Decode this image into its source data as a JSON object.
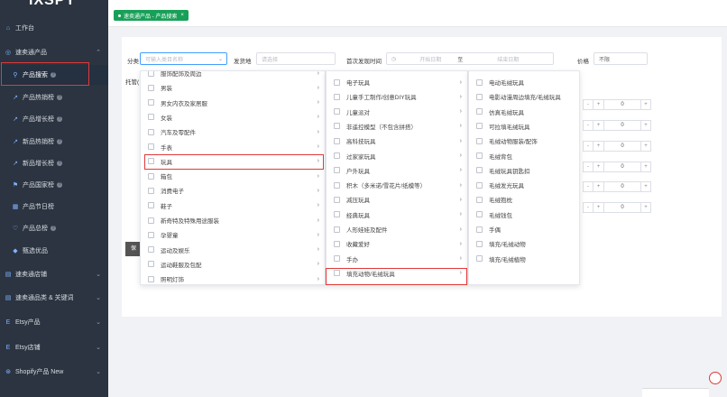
{
  "app": {
    "logo": "IXSPY",
    "fragment_top": "..."
  },
  "sidebar": {
    "workspace": "工作台",
    "groups": [
      {
        "label": "速卖通产品"
      },
      {
        "label": "速卖通店铺"
      },
      {
        "label": "速卖通品类 & 关键词"
      },
      {
        "label": "Etsy产品"
      },
      {
        "label": "Etsy店铺"
      },
      {
        "label": "Shopify产品 New"
      }
    ],
    "sub_items": [
      {
        "label": "产品搜索"
      },
      {
        "label": "产品热销榜"
      },
      {
        "label": "产品增长榜"
      },
      {
        "label": "新品热销榜"
      },
      {
        "label": "新品增长榜"
      },
      {
        "label": "产品国家榜"
      },
      {
        "label": "产品节日榜"
      },
      {
        "label": "产品总榜"
      },
      {
        "label": "甄选优品"
      }
    ]
  },
  "tabs": [
    {
      "label": "速卖通产品 - 产品搜索",
      "close": "×"
    }
  ],
  "filters": {
    "category_label": "分类",
    "category_placeholder": "可输入类目名称",
    "ship_from_label": "发货地",
    "ship_from_placeholder": "请选择",
    "first_found_label": "首次发现时间",
    "start_placeholder": "开始日期",
    "to_label": "至",
    "end_placeholder": "结束日期",
    "price_label": "价格",
    "price_value": "不限",
    "trusteeship_label": "托管(",
    "save_fragment": "保"
  },
  "steppers": [
    {
      "value": "0"
    },
    {
      "value": "0"
    },
    {
      "value": "0"
    },
    {
      "value": "0"
    },
    {
      "value": "0"
    },
    {
      "value": "0"
    },
    {
      "value": "0"
    }
  ],
  "cascader": {
    "col1": [
      "服饰配饰及周边",
      "男装",
      "男女内衣及家居服",
      "女装",
      "汽车及零配件",
      "手表",
      "玩具",
      "箱包",
      "消费电子",
      "鞋子",
      "新奇特及特殊用途服装",
      "孕婴童",
      "运动及娱乐",
      "运动鞋服及包配",
      "照明灯饰"
    ],
    "col2": [
      "电子玩具",
      "儿童手工制作/创意DIY玩具",
      "儿童派对",
      "非遥控模型（不包含拼搭）",
      "高科技玩具",
      "过家家玩具",
      "户外玩具",
      "积木（多米诺/雪花片/纸模等）",
      "减压玩具",
      "经典玩具",
      "人形娃娃及配件",
      "收藏爱好",
      "手办",
      "填充动物/毛绒玩具"
    ],
    "col3": [
      "电动毛绒玩具",
      "电影动漫周边填充/毛绒玩具",
      "仿真毛绒玩具",
      "可拉填毛绒玩具",
      "毛绒动物服装/配饰",
      "毛绒背包",
      "毛绒玩具钥匙扣",
      "毛绒发光玩具",
      "毛绒抱枕",
      "毛绒钱包",
      "手偶",
      "填充/毛绒动物",
      "填充/毛绒植物"
    ]
  },
  "colors": {
    "sidebar_bg": "#2b3440",
    "accent": "#409eff",
    "tag_green": "#18a058",
    "highlight_red": "#e03a3a"
  }
}
